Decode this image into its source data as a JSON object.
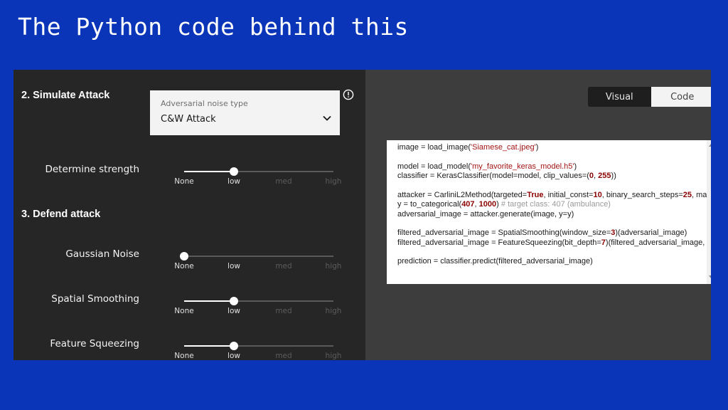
{
  "slide": {
    "title": "The Python code behind this"
  },
  "attack_section": {
    "heading": "2. Simulate Attack",
    "dropdown": {
      "label": "Adversarial noise type",
      "value": "C&W Attack"
    }
  },
  "tick_labels": [
    "None",
    "low",
    "med",
    "high"
  ],
  "sliders": [
    {
      "label": "Determine strength",
      "value_index": 1,
      "value": "low"
    },
    {
      "label": "Gaussian Noise",
      "value_index": 0,
      "value": "None"
    },
    {
      "label": "Spatial Smoothing",
      "value_index": 1,
      "value": "low"
    },
    {
      "label": "Feature Squeezing",
      "value_index": 1,
      "value": "low"
    }
  ],
  "defend_section": {
    "heading": "3. Defend attack"
  },
  "view_toggle": {
    "visual_label": "Visual",
    "code_label": "Code",
    "selected": "Code"
  },
  "code": {
    "lines": [
      [
        [
          "t",
          "image = load_image("
        ],
        [
          "s",
          "'Siamese_cat.jpeg'"
        ],
        [
          "t",
          ")"
        ]
      ],
      [],
      [
        [
          "t",
          "model = load_model("
        ],
        [
          "s",
          "'my_favorite_keras_model.h5'"
        ],
        [
          "t",
          ")"
        ]
      ],
      [
        [
          "t",
          "classifier = KerasClassifier(model=model, clip_values=("
        ],
        [
          "k",
          "0"
        ],
        [
          "t",
          ", "
        ],
        [
          "k",
          "255"
        ],
        [
          "t",
          "))"
        ]
      ],
      [],
      [
        [
          "t",
          "attacker = CarliniL2Method(targeted="
        ],
        [
          "k",
          "True"
        ],
        [
          "t",
          ", initial_const="
        ],
        [
          "k",
          "10"
        ],
        [
          "t",
          ", binary_search_steps="
        ],
        [
          "k",
          "25"
        ],
        [
          "t",
          ", ma"
        ]
      ],
      [
        [
          "t",
          "y = to_categorical("
        ],
        [
          "k",
          "407"
        ],
        [
          "t",
          ", "
        ],
        [
          "k",
          "1000"
        ],
        [
          "t",
          ") "
        ],
        [
          "c",
          "# target class: 407 (ambulance)"
        ]
      ],
      [
        [
          "t",
          "adversarial_image = attacker.generate(image, y=y)"
        ]
      ],
      [],
      [
        [
          "t",
          "filtered_adversarial_image = SpatialSmoothing(window_size="
        ],
        [
          "k",
          "3"
        ],
        [
          "t",
          ")(adversarial_image)"
        ]
      ],
      [
        [
          "t",
          "filtered_adversarial_image = FeatureSqueezing(bit_depth="
        ],
        [
          "k",
          "7"
        ],
        [
          "t",
          ")(filtered_adversarial_image,"
        ]
      ],
      [],
      [
        [
          "t",
          "prediction = classifier.predict(filtered_adversarial_image)"
        ]
      ]
    ]
  },
  "colors": {
    "slide_background": "#0a35b8",
    "app_background": "#3d3d3d",
    "panel_background": "#262626",
    "string_literal": "#a31515",
    "keyword_number": "#8b0000",
    "comment": "#9a9a9a"
  },
  "icons": [
    "info-icon",
    "chevron-down-icon"
  ]
}
